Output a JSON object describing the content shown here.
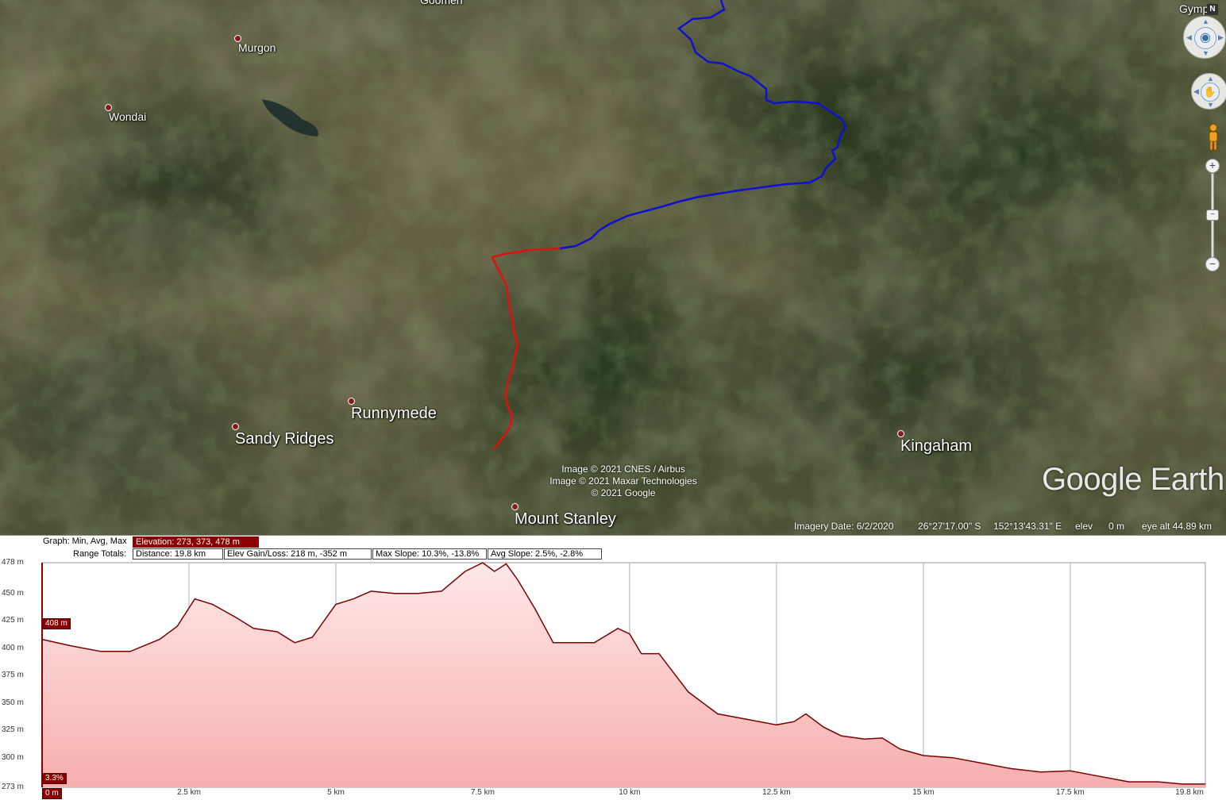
{
  "map": {
    "places": {
      "goomeri": "Goomeri",
      "gympie": "Gympie",
      "murgon": "Murgon",
      "wondai": "Wondai",
      "runnymede": "Runnymede",
      "sandy_ridges": "Sandy Ridges",
      "kingaham": "Kingaham",
      "mount_stanley": "Mount Stanley"
    },
    "attribution": [
      "Image © 2021 CNES / Airbus",
      "Image © 2021 Maxar Technologies",
      "© 2021 Google"
    ],
    "logo": "Google Earth",
    "status": {
      "imagery_date": "Imagery Date: 6/2/2020",
      "latitude": "26°27'17.00\" S",
      "longitude": "152°13'43.31\" E",
      "elev_label": "elev",
      "elev_value": "0 m",
      "eye_alt": "eye alt  44.89 km"
    },
    "controls": {
      "north": "N",
      "zoom_in": "+",
      "zoom_out": "−",
      "zoom_mid": "−"
    },
    "track_colors": {
      "selected": "#e01010",
      "unselected": "#1010d0"
    }
  },
  "profile": {
    "graph_label": "Graph: Min, Avg, Max",
    "elevation_box": "Elevation: 273, 373, 478 m",
    "range_label": "Range Totals:",
    "distance_box": "Distance: 19.8 km",
    "elev_gain_box": "Elev Gain/Loss: 218 m, -352 m",
    "max_slope_box": "Max Slope: 10.3%, -13.8%",
    "avg_slope_box": "Avg Slope: 2.5%, -2.8%",
    "cursor_elev_tag": "408 m",
    "cursor_slope_tag": "3.3%",
    "cursor_dist_tag": "0 m",
    "fill_color": "#f8b8b8",
    "line_color": "#7a0000"
  },
  "chart_data": {
    "type": "area",
    "title": "",
    "xlabel": "",
    "ylabel": "",
    "xlim": [
      0,
      19.8
    ],
    "ylim": [
      273,
      478
    ],
    "x_ticks": [
      "0 m",
      "2.5 km",
      "5 km",
      "7.5 km",
      "10 km",
      "12.5 km",
      "15 km",
      "17.5 km",
      "19.8 km"
    ],
    "y_ticks": [
      "478 m",
      "450 m",
      "425 m",
      "400 m",
      "375 m",
      "350 m",
      "325 m",
      "300 m",
      "273 m"
    ],
    "grid": true,
    "series": [
      {
        "x": [
          0,
          0.5,
          1.0,
          1.5,
          2.0,
          2.3,
          2.6,
          2.9,
          3.3,
          3.6,
          4.0,
          4.3,
          4.6,
          5.0,
          5.3,
          5.6,
          6.0,
          6.4,
          6.8,
          7.2,
          7.5,
          7.7,
          7.9,
          8.1,
          8.4,
          8.7,
          9.0,
          9.4,
          9.8,
          10.0,
          10.2,
          10.5,
          11.0,
          11.5,
          12.0,
          12.5,
          12.8,
          13.0,
          13.3,
          13.6,
          14.0,
          14.3,
          14.6,
          15.0,
          15.5,
          16.0,
          16.5,
          17.0,
          17.5,
          18.0,
          18.5,
          19.0,
          19.4,
          19.8
        ],
        "y": [
          408,
          402,
          397,
          397,
          408,
          420,
          445,
          440,
          428,
          418,
          415,
          405,
          410,
          440,
          445,
          452,
          450,
          450,
          452,
          470,
          478,
          470,
          477,
          462,
          435,
          405,
          405,
          405,
          418,
          413,
          395,
          395,
          360,
          340,
          335,
          330,
          333,
          340,
          328,
          320,
          317,
          318,
          308,
          302,
          300,
          295,
          290,
          287,
          288,
          283,
          278,
          278,
          276,
          276
        ]
      }
    ]
  }
}
